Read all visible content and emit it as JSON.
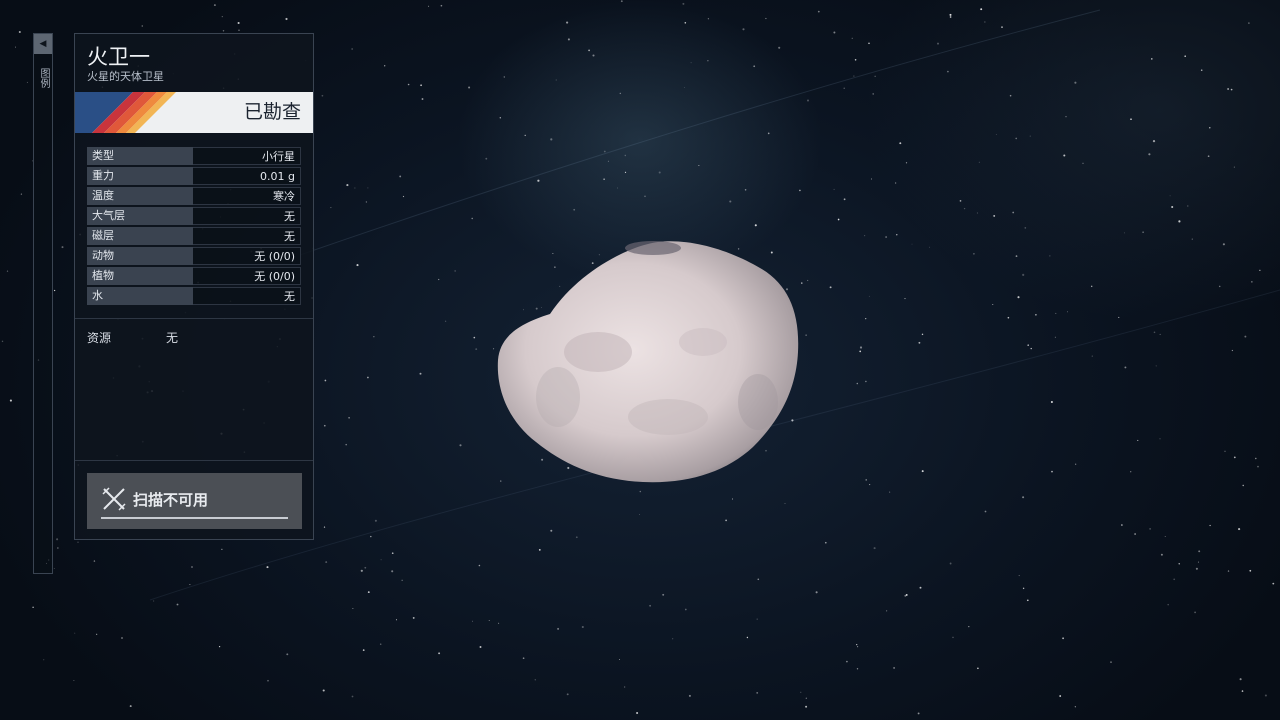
{
  "side_panel": {
    "collapse_icon": "caret-left-icon",
    "label": "图例"
  },
  "body": {
    "name": "火卫一",
    "description": "火星的天体卫星",
    "status": "已勘查",
    "banner_colors": [
      "#2a4f86",
      "#c8343c",
      "#e0583a",
      "#ef8a3e",
      "#f2b555"
    ]
  },
  "stats": [
    {
      "label": "类型",
      "value": "小行星"
    },
    {
      "label": "重力",
      "value": "0.01 g"
    },
    {
      "label": "温度",
      "value": "寒冷"
    },
    {
      "label": "大气层",
      "value": "无"
    },
    {
      "label": "磁层",
      "value": "无"
    },
    {
      "label": "动物",
      "value": "无 (0/0)"
    },
    {
      "label": "植物",
      "value": "无 (0/0)"
    },
    {
      "label": "水",
      "value": "无"
    }
  ],
  "resources": {
    "label": "资源",
    "value": "无"
  },
  "scan": {
    "label": "扫描不可用",
    "icon": "scan-unavailable-icon"
  }
}
